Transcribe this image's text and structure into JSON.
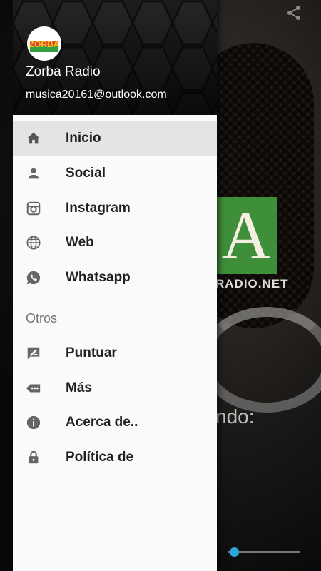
{
  "background": {
    "logo_text": "A",
    "logo_domain": "RADIO.NET",
    "now_playing_fragment": "ndo:",
    "share_icon": "share-icon",
    "accent_color": "#29a8e0"
  },
  "drawer": {
    "header": {
      "app_name": "Zorba Radio",
      "email": "musica20161@outlook.com",
      "avatar_text": "ZORBA"
    },
    "items": [
      {
        "label": "Inicio",
        "icon": "home-icon",
        "active": true
      },
      {
        "label": "Social",
        "icon": "person-icon",
        "active": false
      },
      {
        "label": "Instagram",
        "icon": "instagram-icon",
        "active": false
      },
      {
        "label": "Web",
        "icon": "globe-icon",
        "active": false
      },
      {
        "label": "Whatsapp",
        "icon": "whatsapp-icon",
        "active": false
      }
    ],
    "section_title": "Otros",
    "other_items": [
      {
        "label": "Puntuar",
        "icon": "rate-review-icon"
      },
      {
        "label": "Más",
        "icon": "more-icon"
      },
      {
        "label": "Acerca de..",
        "icon": "info-icon"
      },
      {
        "label": "Política de",
        "icon": "lock-icon"
      }
    ]
  }
}
